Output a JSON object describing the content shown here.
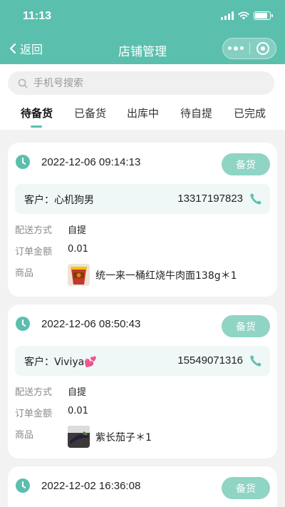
{
  "status_bar": {
    "time": "11:13"
  },
  "nav": {
    "back_label": "返回",
    "title": "店铺管理"
  },
  "search": {
    "placeholder": "手机号搜索"
  },
  "tabs": [
    "待备货",
    "已备货",
    "出库中",
    "待自提",
    "已完成"
  ],
  "labels": {
    "delivery": "配送方式",
    "amount": "订单金额",
    "goods": "商品",
    "stock_button": "备货"
  },
  "orders": [
    {
      "time": "2022-12-06 09:14:13",
      "customer": "客户：心机狗男",
      "phone": "13317197823",
      "delivery": "自提",
      "amount": "0.01",
      "product": "统一来一桶红烧牛肉面138g＊1",
      "product_icon": "noodle-cup"
    },
    {
      "time": "2022-12-06 08:50:43",
      "customer": "客户：Viviya💕",
      "phone": "15549071316",
      "delivery": "自提",
      "amount": "0.01",
      "product": "紫长茄子＊1",
      "product_icon": "eggplant"
    },
    {
      "time": "2022-12-02 16:36:08"
    }
  ],
  "colors": {
    "accent": "#5bbfae",
    "button": "#8fd4c5",
    "customer_bg": "#eff8f6"
  }
}
